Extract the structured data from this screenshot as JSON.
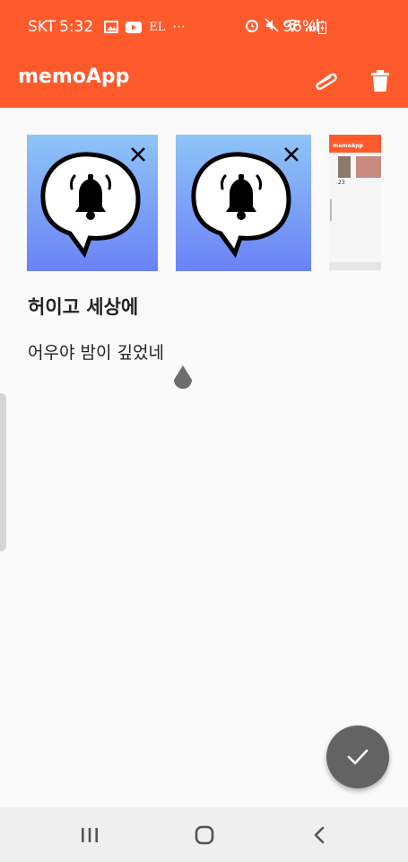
{
  "status_bar": {
    "carrier": "SKT",
    "time": "5:32",
    "notification_icons": [
      "gallery-icon",
      "youtube-icon",
      "el-icon",
      "more-icon"
    ],
    "system_icons": [
      "alarm-icon",
      "mute-icon",
      "wifi-icon",
      "signal-icon"
    ],
    "battery": "96%"
  },
  "app_bar": {
    "title": "memoApp",
    "actions": [
      "attach-icon",
      "delete-icon"
    ]
  },
  "attachments": {
    "items": [
      {
        "name": "bell-speech-bubble-image",
        "removable": true
      },
      {
        "name": "bell-speech-bubble-image",
        "removable": true
      },
      {
        "name": "app-screenshot-preview",
        "removable": false
      }
    ],
    "preview": {
      "app_title": "memoApp",
      "number": "23"
    }
  },
  "memo": {
    "title": "허이고 세상에",
    "body": "어우야 밤이 깊었네"
  },
  "fab": {
    "icon": "check-icon"
  },
  "nav_bar": {
    "buttons": [
      "recent-apps-icon",
      "home-icon",
      "back-icon"
    ]
  },
  "colors": {
    "accent": "#ff5a2c",
    "fab": "#636363",
    "thumb_gradient_top": "#8ec5f7",
    "thumb_gradient_bottom": "#6b82f7"
  }
}
